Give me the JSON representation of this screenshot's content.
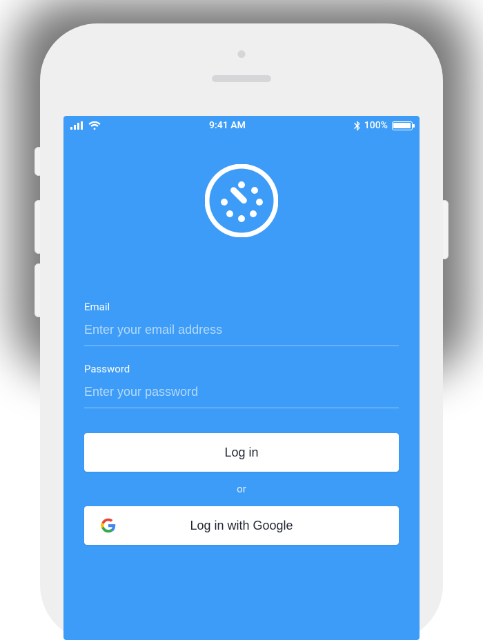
{
  "status": {
    "time": "9:41 AM",
    "battery_text": "100%"
  },
  "form": {
    "email_label": "Email",
    "email_placeholder": "Enter your email address",
    "password_label": "Password",
    "password_placeholder": "Enter your password"
  },
  "buttons": {
    "login": "Log in",
    "or": "or",
    "google": "Log in with Google"
  },
  "colors": {
    "accent": "#3c9cf7"
  }
}
